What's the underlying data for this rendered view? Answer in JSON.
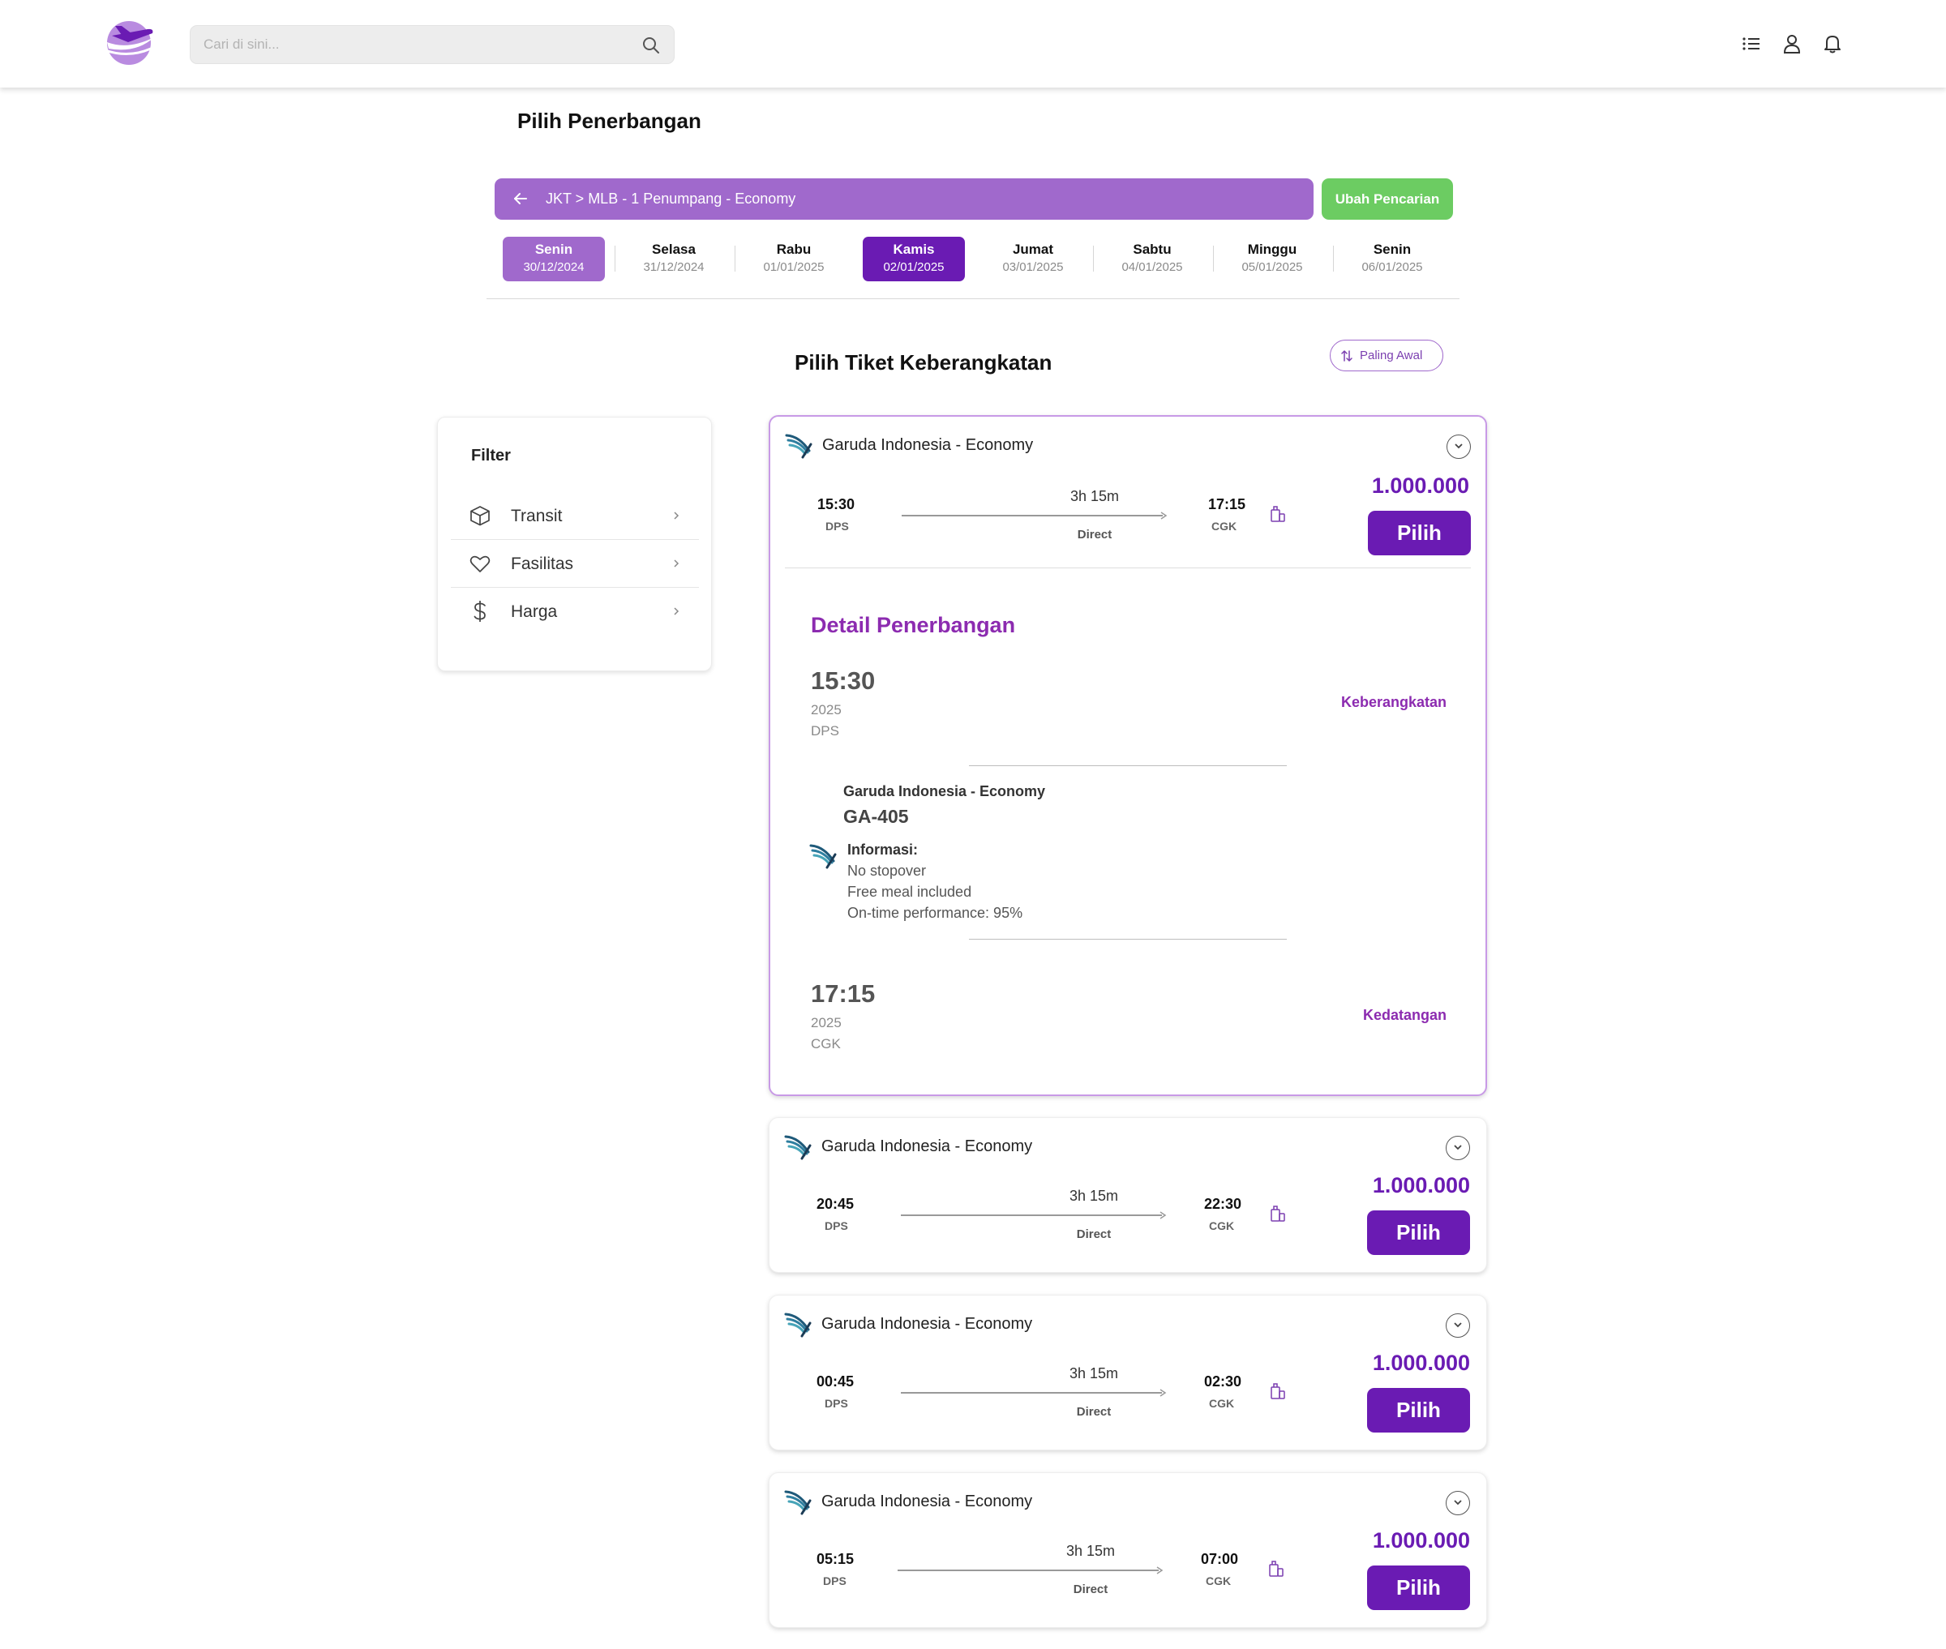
{
  "header": {
    "search_placeholder": "Cari di sini..."
  },
  "page_title": "Pilih Penerbangan",
  "route": {
    "summary": "JKT > MLB - 1 Penumpang - Economy",
    "change_label": "Ubah Pencarian"
  },
  "dates": [
    {
      "day": "Senin",
      "date": "30/12/2024",
      "state": "light"
    },
    {
      "day": "Selasa",
      "date": "31/12/2024",
      "state": "none"
    },
    {
      "day": "Rabu",
      "date": "01/01/2025",
      "state": "none"
    },
    {
      "day": "Kamis",
      "date": "02/01/2025",
      "state": "selected"
    },
    {
      "day": "Jumat",
      "date": "03/01/2025",
      "state": "none"
    },
    {
      "day": "Sabtu",
      "date": "04/01/2025",
      "state": "none"
    },
    {
      "day": "Minggu",
      "date": "05/01/2025",
      "state": "none"
    },
    {
      "day": "Senin",
      "date": "06/01/2025",
      "state": "none"
    }
  ],
  "section_title": "Pilih Tiket Keberangkatan",
  "sort_label": "Paling Awal",
  "filter": {
    "title": "Filter",
    "items": [
      {
        "label": "Transit",
        "icon": "box-icon"
      },
      {
        "label": "Fasilitas",
        "icon": "heart-icon"
      },
      {
        "label": "Harga",
        "icon": "dollar-icon"
      }
    ]
  },
  "flights": [
    {
      "airline": "Garuda Indonesia - Economy",
      "depart_time": "15:30",
      "depart_code": "DPS",
      "duration": "3h 15m",
      "stop": "Direct",
      "arrive_time": "17:15",
      "arrive_code": "CGK",
      "price": "1.000.000",
      "button": "Pilih",
      "expanded": true
    },
    {
      "airline": "Garuda Indonesia - Economy",
      "depart_time": "20:45",
      "depart_code": "DPS",
      "duration": "3h 15m",
      "stop": "Direct",
      "arrive_time": "22:30",
      "arrive_code": "CGK",
      "price": "1.000.000",
      "button": "Pilih",
      "expanded": false
    },
    {
      "airline": "Garuda Indonesia - Economy",
      "depart_time": "00:45",
      "depart_code": "DPS",
      "duration": "3h 15m",
      "stop": "Direct",
      "arrive_time": "02:30",
      "arrive_code": "CGK",
      "price": "1.000.000",
      "button": "Pilih",
      "expanded": false
    },
    {
      "airline": "Garuda Indonesia - Economy",
      "depart_time": "05:15",
      "depart_code": "DPS",
      "duration": "3h 15m",
      "stop": "Direct",
      "arrive_time": "07:00",
      "arrive_code": "CGK",
      "price": "1.000.000",
      "button": "Pilih",
      "expanded": false
    }
  ],
  "detail": {
    "title": "Detail Penerbangan",
    "depart_time": "15:30",
    "depart_year": "2025",
    "depart_code": "DPS",
    "depart_label": "Keberangkatan",
    "airline": "Garuda Indonesia - Economy",
    "flight_no": "GA-405",
    "info_title": "Informasi:",
    "info_lines": [
      "No stopover",
      "Free meal included",
      "On-time performance: 95%"
    ],
    "arrive_time": "17:15",
    "arrive_year": "2025",
    "arrive_code": "CGK",
    "arrive_label": "Kedatangan"
  },
  "colors": {
    "purple_light": "#a069cc",
    "purple_dark": "#6a1bb3",
    "green": "#6ccc62",
    "detail_accent": "#8c2bb0"
  }
}
